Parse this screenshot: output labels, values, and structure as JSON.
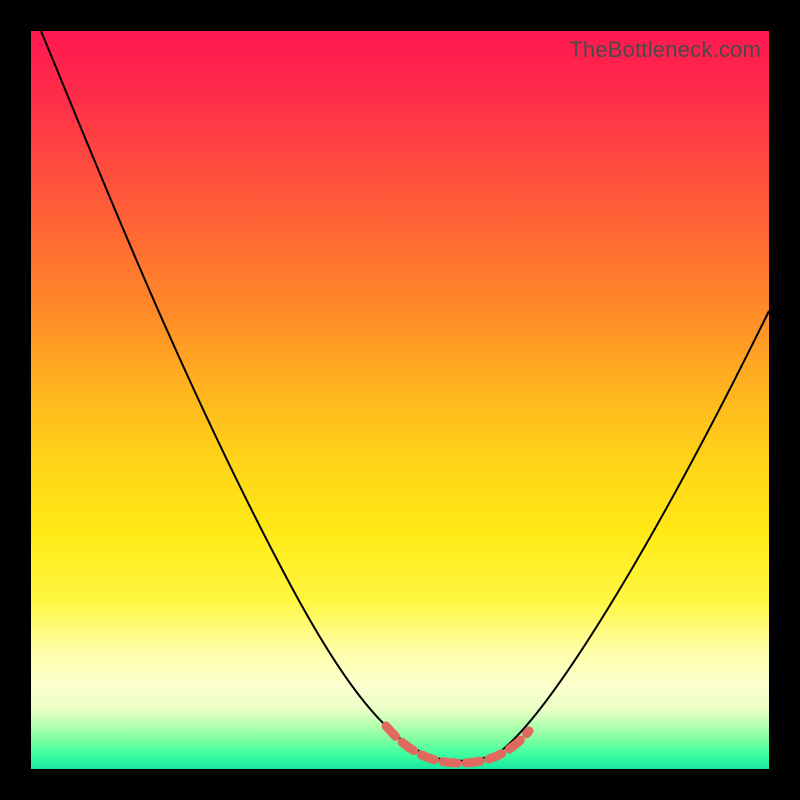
{
  "watermark": "TheBottleneck.com",
  "chart_data": {
    "type": "line",
    "title": "",
    "xlabel": "",
    "ylabel": "",
    "xlim": [
      0,
      100
    ],
    "ylim": [
      0,
      100
    ],
    "grid": false,
    "legend": false,
    "background_gradient": {
      "direction": "top-to-bottom",
      "stops": [
        {
          "pos": 0,
          "color": "#ff1850"
        },
        {
          "pos": 38,
          "color": "#ff8a28"
        },
        {
          "pos": 68,
          "color": "#ffea15"
        },
        {
          "pos": 89,
          "color": "#fbffd0"
        },
        {
          "pos": 100,
          "color": "#18e8a0"
        }
      ]
    },
    "series": [
      {
        "name": "bottleneck-curve",
        "color": "#000000",
        "x": [
          0,
          10,
          20,
          30,
          40,
          48,
          52,
          56,
          60,
          64,
          70,
          80,
          90,
          100
        ],
        "values": [
          100,
          82,
          64,
          46,
          27,
          10,
          3,
          0,
          0,
          3,
          11,
          29,
          48,
          67
        ]
      }
    ],
    "valley_highlight": {
      "color": "#e06a5f",
      "style": "dashed",
      "x": [
        48,
        52,
        56,
        60,
        64
      ],
      "values": [
        10,
        3,
        0,
        0,
        3
      ]
    }
  }
}
